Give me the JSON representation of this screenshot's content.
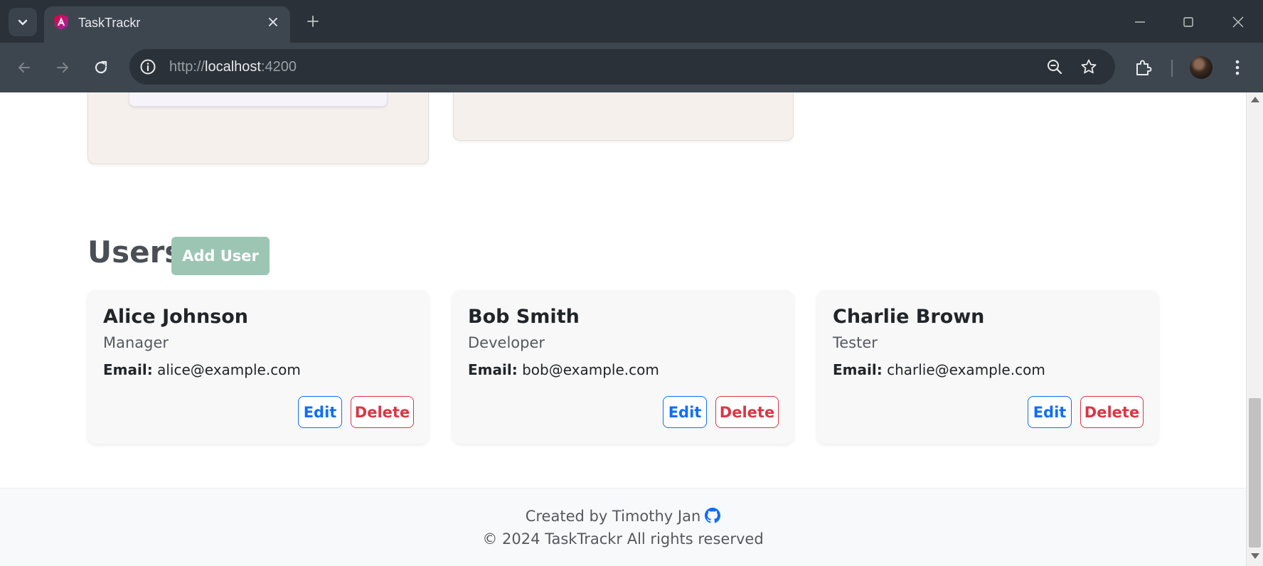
{
  "browser": {
    "tab_title": "TaskTrackr",
    "url_scheme": "http://",
    "url_host": "localhost",
    "url_port": ":4200"
  },
  "users_section": {
    "heading": "Users",
    "add_button": "Add User",
    "email_label": "Email:",
    "edit_label": "Edit",
    "delete_label": "Delete",
    "users": [
      {
        "name": "Alice Johnson",
        "role": "Manager",
        "email": "alice@example.com"
      },
      {
        "name": "Bob Smith",
        "role": "Developer",
        "email": "bob@example.com"
      },
      {
        "name": "Charlie Brown",
        "role": "Tester",
        "email": "charlie@example.com"
      }
    ]
  },
  "footer": {
    "created_by": "Created by Timothy Jan",
    "copyright": "© 2024 TaskTrackr All rights reserved"
  },
  "colors": {
    "primary": "#0d6efd",
    "danger": "#dc3545",
    "add_user_bg": "#9cc6b3",
    "column_bg": "#f6f0ed"
  },
  "icons": [
    "tab-search-icon",
    "angular-logo-icon",
    "close-icon",
    "plus-icon",
    "minimize-icon",
    "maximize-icon",
    "back-icon",
    "forward-icon",
    "reload-icon",
    "site-info-icon",
    "zoom-out-icon",
    "star-icon",
    "extensions-icon",
    "menu-icon",
    "github-icon"
  ]
}
